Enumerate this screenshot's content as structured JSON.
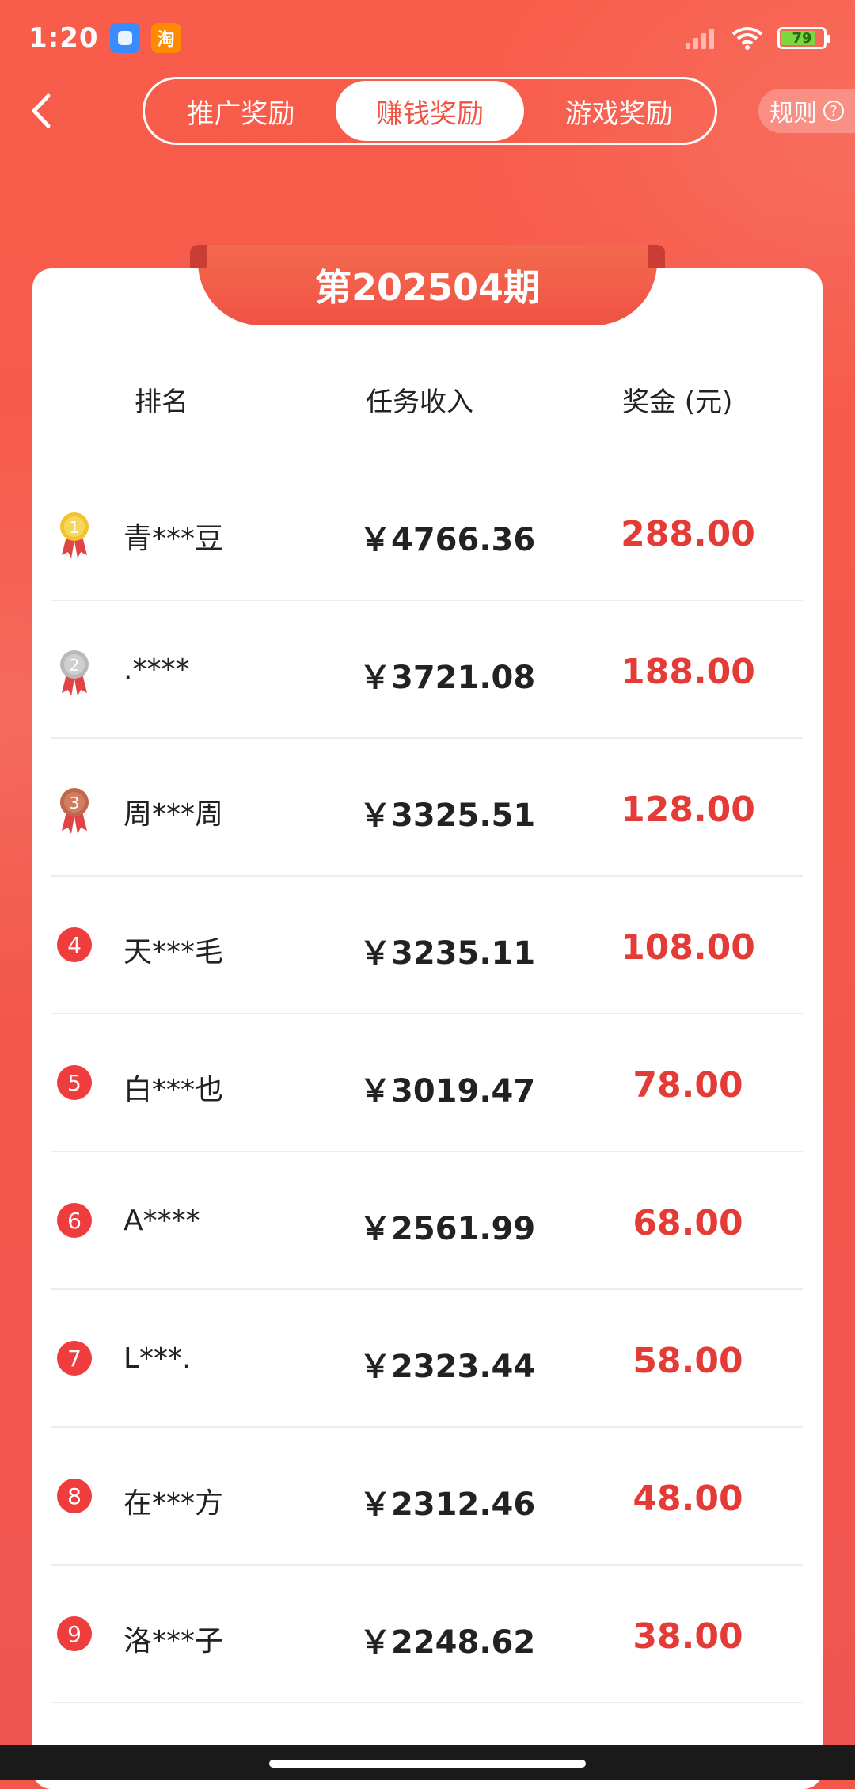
{
  "status_bar": {
    "time": "1:20",
    "app1_icon": "blue-app-icon",
    "app2_label": "淘",
    "battery": "79"
  },
  "tabs": [
    {
      "label": "推广奖励",
      "active": false
    },
    {
      "label": "赚钱奖励",
      "active": true
    },
    {
      "label": "游戏奖励",
      "active": false
    }
  ],
  "rules_label": "规则",
  "period_title": "第202504期",
  "columns": {
    "rank": "排名",
    "income": "任务收入",
    "prize": "奖金 (元)"
  },
  "rows": [
    {
      "rank": "1",
      "name": "青***豆",
      "income": "￥4766.36",
      "prize": "288.00"
    },
    {
      "rank": "2",
      "name": ".****",
      "income": "￥3721.08",
      "prize": "188.00"
    },
    {
      "rank": "3",
      "name": "周***周",
      "income": "￥3325.51",
      "prize": "128.00"
    },
    {
      "rank": "4",
      "name": "天***毛",
      "income": "￥3235.11",
      "prize": "108.00"
    },
    {
      "rank": "5",
      "name": "白***也",
      "income": "￥3019.47",
      "prize": "78.00"
    },
    {
      "rank": "6",
      "name": "A****",
      "income": "￥2561.99",
      "prize": "68.00"
    },
    {
      "rank": "7",
      "name": "L***.",
      "income": "￥2323.44",
      "prize": "58.00"
    },
    {
      "rank": "8",
      "name": "在***方",
      "income": "￥2312.46",
      "prize": "48.00"
    },
    {
      "rank": "9",
      "name": "洛***子",
      "income": "￥2248.62",
      "prize": "38.00"
    }
  ],
  "colors": {
    "accent": "#f05346",
    "prize": "#e43b36",
    "gold": "#f2c230",
    "silver": "#b9b9b9",
    "bronze": "#c0664a"
  }
}
